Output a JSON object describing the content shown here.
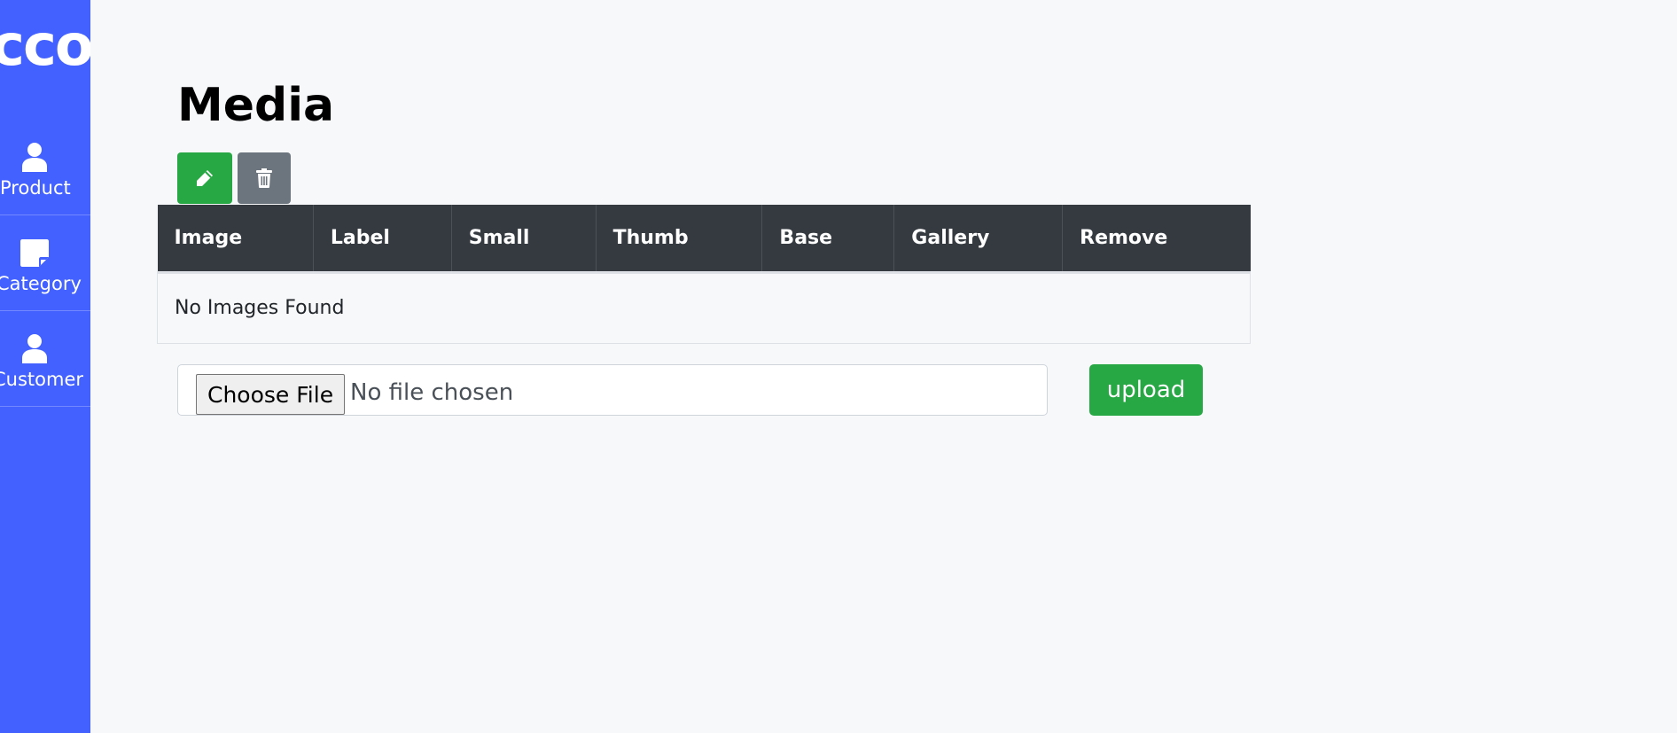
{
  "sidebar": {
    "logo": "cco",
    "items": [
      {
        "label": "Product",
        "icon": "user-icon"
      },
      {
        "label": "Category",
        "icon": "sticky-note-icon"
      },
      {
        "label": "Customer",
        "icon": "user-icon"
      }
    ],
    "color": "#4361ff"
  },
  "page": {
    "title": "Media"
  },
  "toolbar": {
    "edit_icon": "pencil-icon",
    "delete_icon": "trash-icon",
    "edit_color": "#28a745",
    "delete_color": "#6c757d"
  },
  "table": {
    "columns": [
      "Image",
      "Label",
      "Small",
      "Thumb",
      "Base",
      "Gallery",
      "Remove"
    ],
    "empty_message": "No Images Found",
    "header_color": "#343a40"
  },
  "upload": {
    "choose_label": "Choose File",
    "status_text": "No file chosen",
    "button_label": "upload"
  }
}
